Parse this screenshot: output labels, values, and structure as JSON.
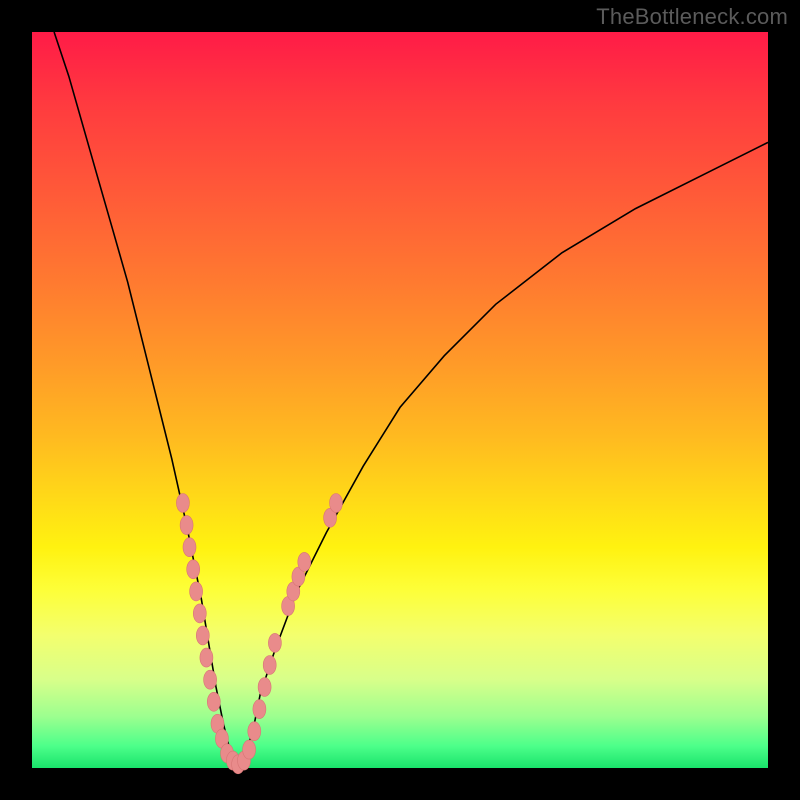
{
  "watermark": "TheBottleneck.com",
  "colors": {
    "page_bg": "#000000",
    "watermark_text": "#5b5b5b",
    "curve_stroke": "#000000",
    "marker_fill": "#e98b8b",
    "gradient_stops": [
      "#ff1b47",
      "#ff3b3f",
      "#ff5a38",
      "#ff7a30",
      "#ff9a28",
      "#ffba20",
      "#ffd818",
      "#fff210",
      "#fdff3a",
      "#f3ff6e",
      "#d8ff8a",
      "#9cff8f",
      "#4dff8a",
      "#19e36b"
    ]
  },
  "chart_data": {
    "type": "line",
    "title": "",
    "xlabel": "",
    "ylabel": "",
    "xlim": [
      0,
      100
    ],
    "ylim": [
      0,
      100
    ],
    "grid": false,
    "legend": false,
    "series": [
      {
        "name": "bottleneck-curve",
        "x": [
          3,
          5,
          7,
          9,
          11,
          13,
          15,
          17,
          19,
          21,
          22,
          23,
          24,
          25,
          26,
          27,
          28,
          29,
          30,
          31,
          33,
          36,
          40,
          45,
          50,
          56,
          63,
          72,
          82,
          92,
          100
        ],
        "y": [
          100,
          94,
          87,
          80,
          73,
          66,
          58,
          50,
          42,
          33,
          28,
          23,
          17,
          11,
          6,
          2,
          0,
          2,
          5,
          10,
          16,
          24,
          32,
          41,
          49,
          56,
          63,
          70,
          76,
          81,
          85
        ]
      }
    ],
    "markers": [
      {
        "name": "marker",
        "x": 20.5,
        "y": 36
      },
      {
        "name": "marker",
        "x": 21.0,
        "y": 33
      },
      {
        "name": "marker",
        "x": 21.4,
        "y": 30
      },
      {
        "name": "marker",
        "x": 21.9,
        "y": 27
      },
      {
        "name": "marker",
        "x": 22.3,
        "y": 24
      },
      {
        "name": "marker",
        "x": 22.8,
        "y": 21
      },
      {
        "name": "marker",
        "x": 23.2,
        "y": 18
      },
      {
        "name": "marker",
        "x": 23.7,
        "y": 15
      },
      {
        "name": "marker",
        "x": 24.2,
        "y": 12
      },
      {
        "name": "marker",
        "x": 24.7,
        "y": 9
      },
      {
        "name": "marker",
        "x": 25.2,
        "y": 6
      },
      {
        "name": "marker",
        "x": 25.8,
        "y": 4
      },
      {
        "name": "marker",
        "x": 26.5,
        "y": 2
      },
      {
        "name": "marker",
        "x": 27.3,
        "y": 1
      },
      {
        "name": "marker",
        "x": 28.0,
        "y": 0.5
      },
      {
        "name": "marker",
        "x": 28.8,
        "y": 1
      },
      {
        "name": "marker",
        "x": 29.5,
        "y": 2.5
      },
      {
        "name": "marker",
        "x": 30.2,
        "y": 5
      },
      {
        "name": "marker",
        "x": 30.9,
        "y": 8
      },
      {
        "name": "marker",
        "x": 31.6,
        "y": 11
      },
      {
        "name": "marker",
        "x": 32.3,
        "y": 14
      },
      {
        "name": "marker",
        "x": 33.0,
        "y": 17
      },
      {
        "name": "marker",
        "x": 34.8,
        "y": 22
      },
      {
        "name": "marker",
        "x": 35.5,
        "y": 24
      },
      {
        "name": "marker",
        "x": 36.2,
        "y": 26
      },
      {
        "name": "marker",
        "x": 37.0,
        "y": 28
      },
      {
        "name": "marker",
        "x": 40.5,
        "y": 34
      },
      {
        "name": "marker",
        "x": 41.3,
        "y": 36
      }
    ]
  }
}
